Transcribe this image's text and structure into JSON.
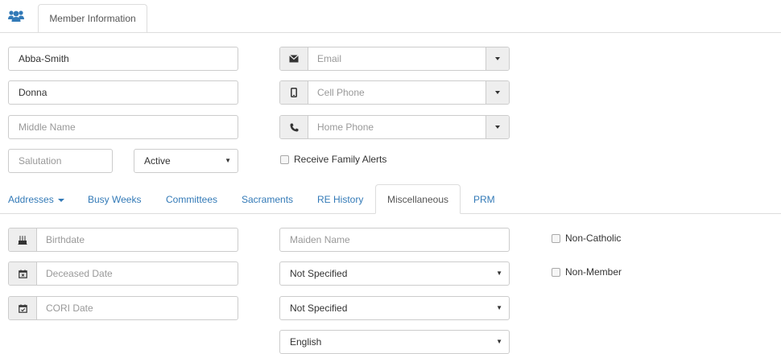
{
  "header": {
    "tab_label": "Member Information"
  },
  "member": {
    "last_name": "Abba-Smith",
    "first_name": "Donna",
    "middle_placeholder": "Middle Name",
    "salutation_placeholder": "Salutation",
    "status_value": "Active",
    "email_placeholder": "Email",
    "cell_placeholder": "Cell Phone",
    "home_placeholder": "Home Phone",
    "family_alerts_label": "Receive Family Alerts"
  },
  "tabs": [
    {
      "label": "Addresses"
    },
    {
      "label": "Busy Weeks"
    },
    {
      "label": "Committees"
    },
    {
      "label": "Sacraments"
    },
    {
      "label": "RE History"
    },
    {
      "label": "Miscellaneous"
    },
    {
      "label": "PRM"
    }
  ],
  "misc": {
    "birthdate_placeholder": "Birthdate",
    "deceased_placeholder": "Deceased Date",
    "cori_placeholder": "CORI Date",
    "maiden_placeholder": "Maiden Name",
    "select1_value": "Not Specified",
    "select2_value": "Not Specified",
    "language_value": "English",
    "non_catholic_label": "Non-Catholic",
    "non_member_label": "Non-Member"
  },
  "colors": {
    "link": "#337ab7",
    "border": "#cccccc",
    "addon_bg": "#eeeeee"
  },
  "icons": [
    "users-icon",
    "envelope-icon",
    "mobile-icon",
    "phone-icon",
    "birthday-cake-icon",
    "calendar-x-icon",
    "calendar-check-icon",
    "caret-down-icon"
  ]
}
